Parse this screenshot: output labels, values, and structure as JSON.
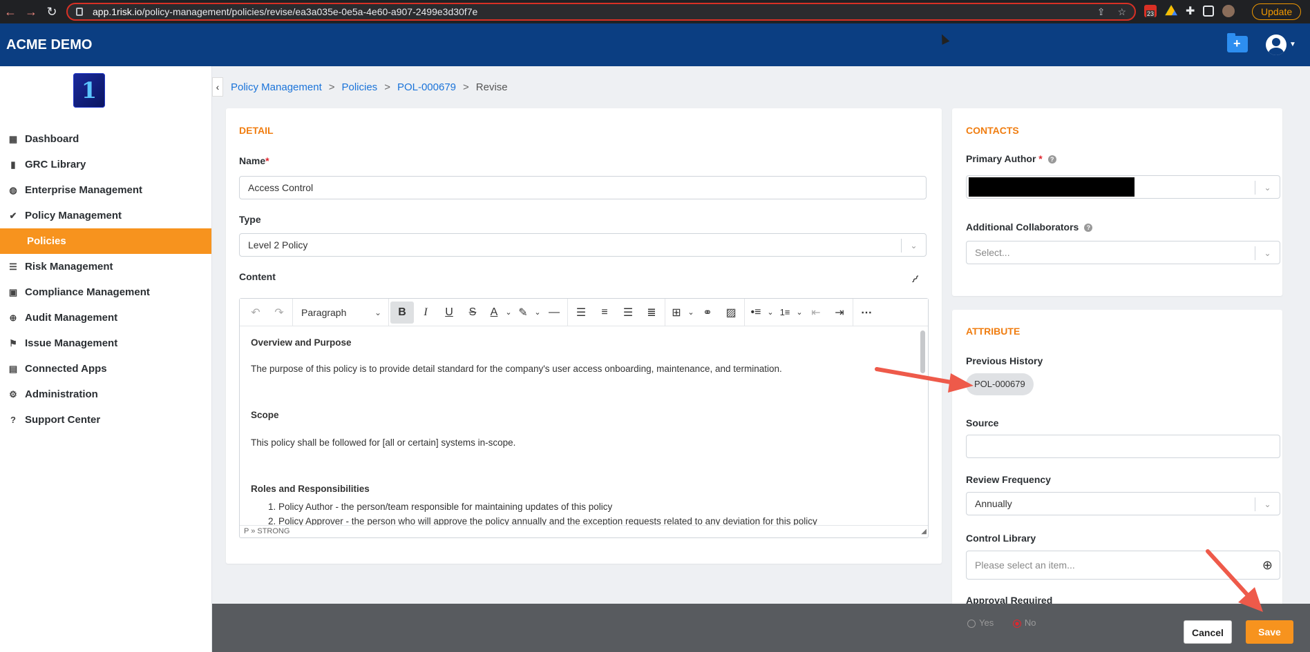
{
  "browser": {
    "url_host": "app.1risk.io",
    "url_path": "/policy-management/policies/revise/ea3a035e-0e5a-4e60-a907-2499e3d30f7e",
    "update_label": "Update",
    "ext_badge": "23"
  },
  "app": {
    "brand": "ACME DEMO",
    "logo_glyph": "1"
  },
  "sidebar": {
    "items": [
      {
        "label": "Dashboard",
        "icon": "dashboard-icon",
        "glyph": "▦"
      },
      {
        "label": "GRC Library",
        "icon": "book-icon",
        "glyph": "▮"
      },
      {
        "label": "Enterprise Management",
        "icon": "globe-icon",
        "glyph": "◍"
      },
      {
        "label": "Policy Management",
        "icon": "check-icon",
        "glyph": "✔"
      },
      {
        "label": "Policies",
        "icon": "",
        "glyph": ""
      },
      {
        "label": "Risk Management",
        "icon": "list-icon",
        "glyph": "☰"
      },
      {
        "label": "Compliance Management",
        "icon": "clipboard-check-icon",
        "glyph": "▣"
      },
      {
        "label": "Audit Management",
        "icon": "crosshair-icon",
        "glyph": "⊕"
      },
      {
        "label": "Issue Management",
        "icon": "flag-icon",
        "glyph": "⚑"
      },
      {
        "label": "Connected Apps",
        "icon": "layers-icon",
        "glyph": "▤"
      },
      {
        "label": "Administration",
        "icon": "gear-icon",
        "glyph": "⚙"
      },
      {
        "label": "Support Center",
        "icon": "question-icon",
        "glyph": "?"
      }
    ]
  },
  "breadcrumb": {
    "items": [
      "Policy Management",
      "Policies",
      "POL-000679"
    ],
    "current": "Revise",
    "sep": ">"
  },
  "detail": {
    "title": "DETAIL",
    "name_label": "Name",
    "name_value": "Access Control",
    "type_label": "Type",
    "type_value": "Level 2 Policy",
    "content_label": "Content",
    "editor": {
      "block_format": "Paragraph",
      "status_path": "P » STRONG",
      "lines": [
        {
          "text": "Overview and Purpose",
          "style": "heading"
        },
        {
          "text": "The purpose of this policy is to provide detail standard for the company's user access onboarding, maintenance, and termination.",
          "style": "body"
        },
        {
          "text": "Scope",
          "style": "heading"
        },
        {
          "text": "This policy shall be followed for [all or certain] systems in-scope.",
          "style": "body"
        },
        {
          "text": "Roles and Responsibilities",
          "style": "heading"
        },
        {
          "text": "1. Policy Author - the person/team responsible for maintaining updates of this policy",
          "style": "list"
        },
        {
          "text": "2. Policy Approver - the person who will approve the policy annually and the exception requests related to any deviation for this policy",
          "style": "list"
        }
      ]
    }
  },
  "contacts": {
    "title": "CONTACTS",
    "primary_author_label": "Primary Author",
    "collaborators_label": "Additional Collaborators",
    "collaborators_placeholder": "Select..."
  },
  "attribute": {
    "title": "ATTRIBUTE",
    "previous_history_label": "Previous History",
    "previous_history_chip": "POL-000679",
    "source_label": "Source",
    "source_value": "",
    "review_frequency_label": "Review Frequency",
    "review_frequency_value": "Annually",
    "control_library_label": "Control Library",
    "control_library_placeholder": "Please select an item...",
    "approval_required_label": "Approval Required",
    "approval_yes": "Yes",
    "approval_no": "No"
  },
  "footer": {
    "cancel_label": "Cancel",
    "save_label": "Save"
  },
  "colors": {
    "header": "#0b3e82",
    "accent": "#f7931e",
    "section_title": "#f07d10",
    "link": "#1a73d9",
    "annotation_arrow": "#ee5a4a"
  }
}
